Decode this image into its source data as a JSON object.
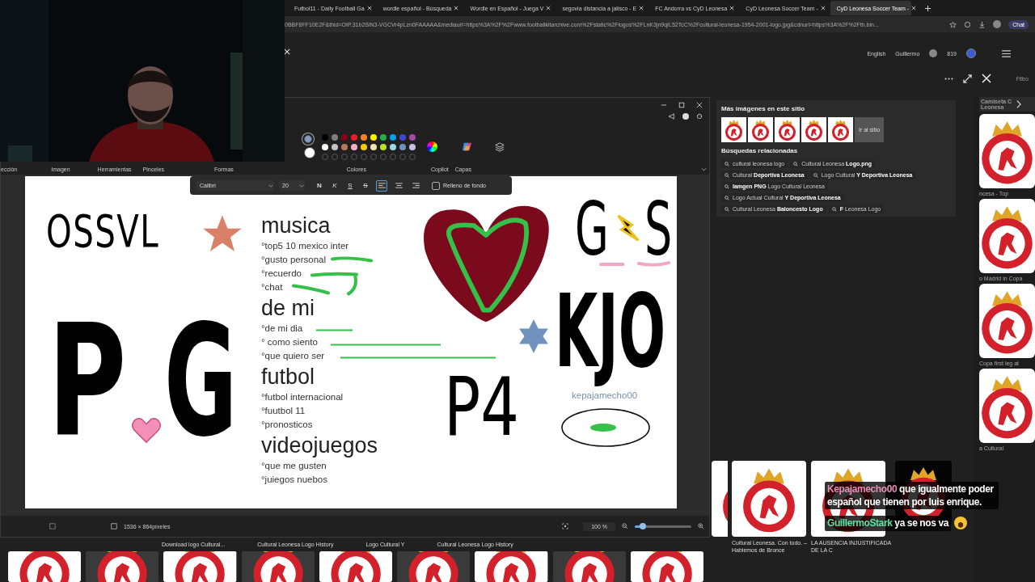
{
  "browser": {
    "tabs": [
      {
        "title": "Futbol11 - Daily Football Ga",
        "selected": false
      },
      {
        "title": "wordle español - Búsqueda",
        "selected": false
      },
      {
        "title": "Wordle en Español - Juega V",
        "selected": false
      },
      {
        "title": "segovia distancia a jalisco - E",
        "selected": false
      },
      {
        "title": "FC Andorra vs CyD Leonesa",
        "selected": false
      },
      {
        "title": "CyD Leonesa Soccer Team -",
        "selected": false
      },
      {
        "title": "CyD Leonesa Soccer Team -",
        "selected": true
      }
    ],
    "address": "0BBF8FF10E2F&thid=OIP.31b2SlN3-VGCVr4pLzn0FAAAAA&mediaurl=https%3A%2F%2Fwww.footballkitarchive.com%2Fstatic%2Flogos%2FLnK3jn9qIL52TcC%2Fcultural-leonesa-1954-2001-logo.jpg&cdnurl=https%3A%2F%2Fth.bin...",
    "copilot": "Chat"
  },
  "header": {
    "language": "English",
    "user": "Guillermo",
    "points": "819",
    "filter": "Filtro"
  },
  "paint": {
    "ribbon_labels": [
      "ección",
      "Imagen",
      "Herramientas",
      "Pinceles",
      "Formas",
      "Colores",
      "Copilot",
      "Capas"
    ],
    "active_colors": [
      {
        "color": "#7f9cc8",
        "selected": true
      },
      {
        "color": "#ffffff",
        "selected": false
      }
    ],
    "palette": [
      {
        "color": "#000000"
      },
      {
        "color": "#7f7f7f"
      },
      {
        "color": "#880015"
      },
      {
        "color": "#ed1c24"
      },
      {
        "color": "#ff7f27"
      },
      {
        "color": "#fff200"
      },
      {
        "color": "#22b14c"
      },
      {
        "color": "#00a2e8"
      },
      {
        "color": "#3f48cc"
      },
      {
        "color": "#a349a4"
      },
      {
        "color": "#ffffff"
      },
      {
        "color": "#c3c3c3"
      },
      {
        "color": "#b97a57"
      },
      {
        "color": "#ffaec9"
      },
      {
        "color": "#ffc90e"
      },
      {
        "color": "#efe4b0"
      },
      {
        "color": "#b5e61d"
      },
      {
        "color": "#99d9ea"
      },
      {
        "color": "#7092be"
      },
      {
        "color": "#c8bfe7"
      }
    ],
    "text_toolbar": {
      "font": "Calibri",
      "size": "20",
      "styles": [
        "N",
        "K",
        "S",
        "S"
      ],
      "align": [
        {
          "selected": true
        },
        {
          "selected": false
        },
        {
          "selected": false
        }
      ],
      "fill_label": "Relleno de fondo",
      "fill_checked": false
    },
    "canvas": {
      "doodles": [
        "OSSVL",
        "G",
        "S",
        "P",
        "G",
        "KJO",
        "P4"
      ],
      "sections": [
        {
          "heading": "musica",
          "items": [
            "°top5 10 mexico inter",
            "°gusto personal",
            "°recuerdo",
            "°chat"
          ]
        },
        {
          "heading": "de mi",
          "items": [
            "°de mi dia",
            "° como siento",
            "°que quiero ser"
          ]
        },
        {
          "heading": "futbol",
          "items": [
            "°futbol internacional",
            "°fuutbol 11",
            "°pronosticos"
          ]
        },
        {
          "heading": "videojuegos",
          "items": [
            "°que me gusten",
            "°juiegos nuebos"
          ]
        }
      ],
      "signature": "kepajamecho00"
    },
    "status": {
      "size": "1536 × 864píxeles",
      "zoom": "100 %",
      "zoom_slider": {
        "level": 0.14
      }
    }
  },
  "details": {
    "more_title": "Más imágenes en este sitio",
    "site_link": "Ir al sitio",
    "related_title": "Búsquedas relacionadas",
    "related": [
      "cultural leonesa logo",
      "Cultural Leonesa **Logo.png**",
      "Cultural **Deportiva Leonesa**",
      "Logo Cultural **Y Deportiva Leonesa**",
      "**Iamgen PNG** Logo Cultural Leonesa",
      "Logo Actual Cultural **Y Deportiva Leonesa**",
      "Cultural Leonesa **Baloncesto Logo**",
      "**F** Leonesa Logo"
    ]
  },
  "side_strip": {
    "title": "Camiseta C\nLeonesa",
    "captions": [
      "ncesa - Top",
      "o Madrid in Copa",
      "Copa first leg at",
      "a Cultural"
    ]
  },
  "results": [
    {
      "caption": "Cultural Leonesa. Con todo. –\nHablemos de Bronce"
    },
    {
      "caption": "LA AUSENCIA INJUSTIFICADA\nDE LA C"
    }
  ],
  "bottom_strip": [
    "Download logo Cultural...",
    "Cultural Leonesa Logo History",
    "Logo Cultural Y",
    "Cultural Leonesa Logo History"
  ],
  "chat": [
    {
      "user": "Kepajamecho00",
      "color": "#e58db4",
      "text": "que igualmente poder español que tienen por luis enrique."
    },
    {
      "user": "GuillermoStark",
      "color": "#5ee0a0",
      "text": "ya se nos va"
    }
  ]
}
